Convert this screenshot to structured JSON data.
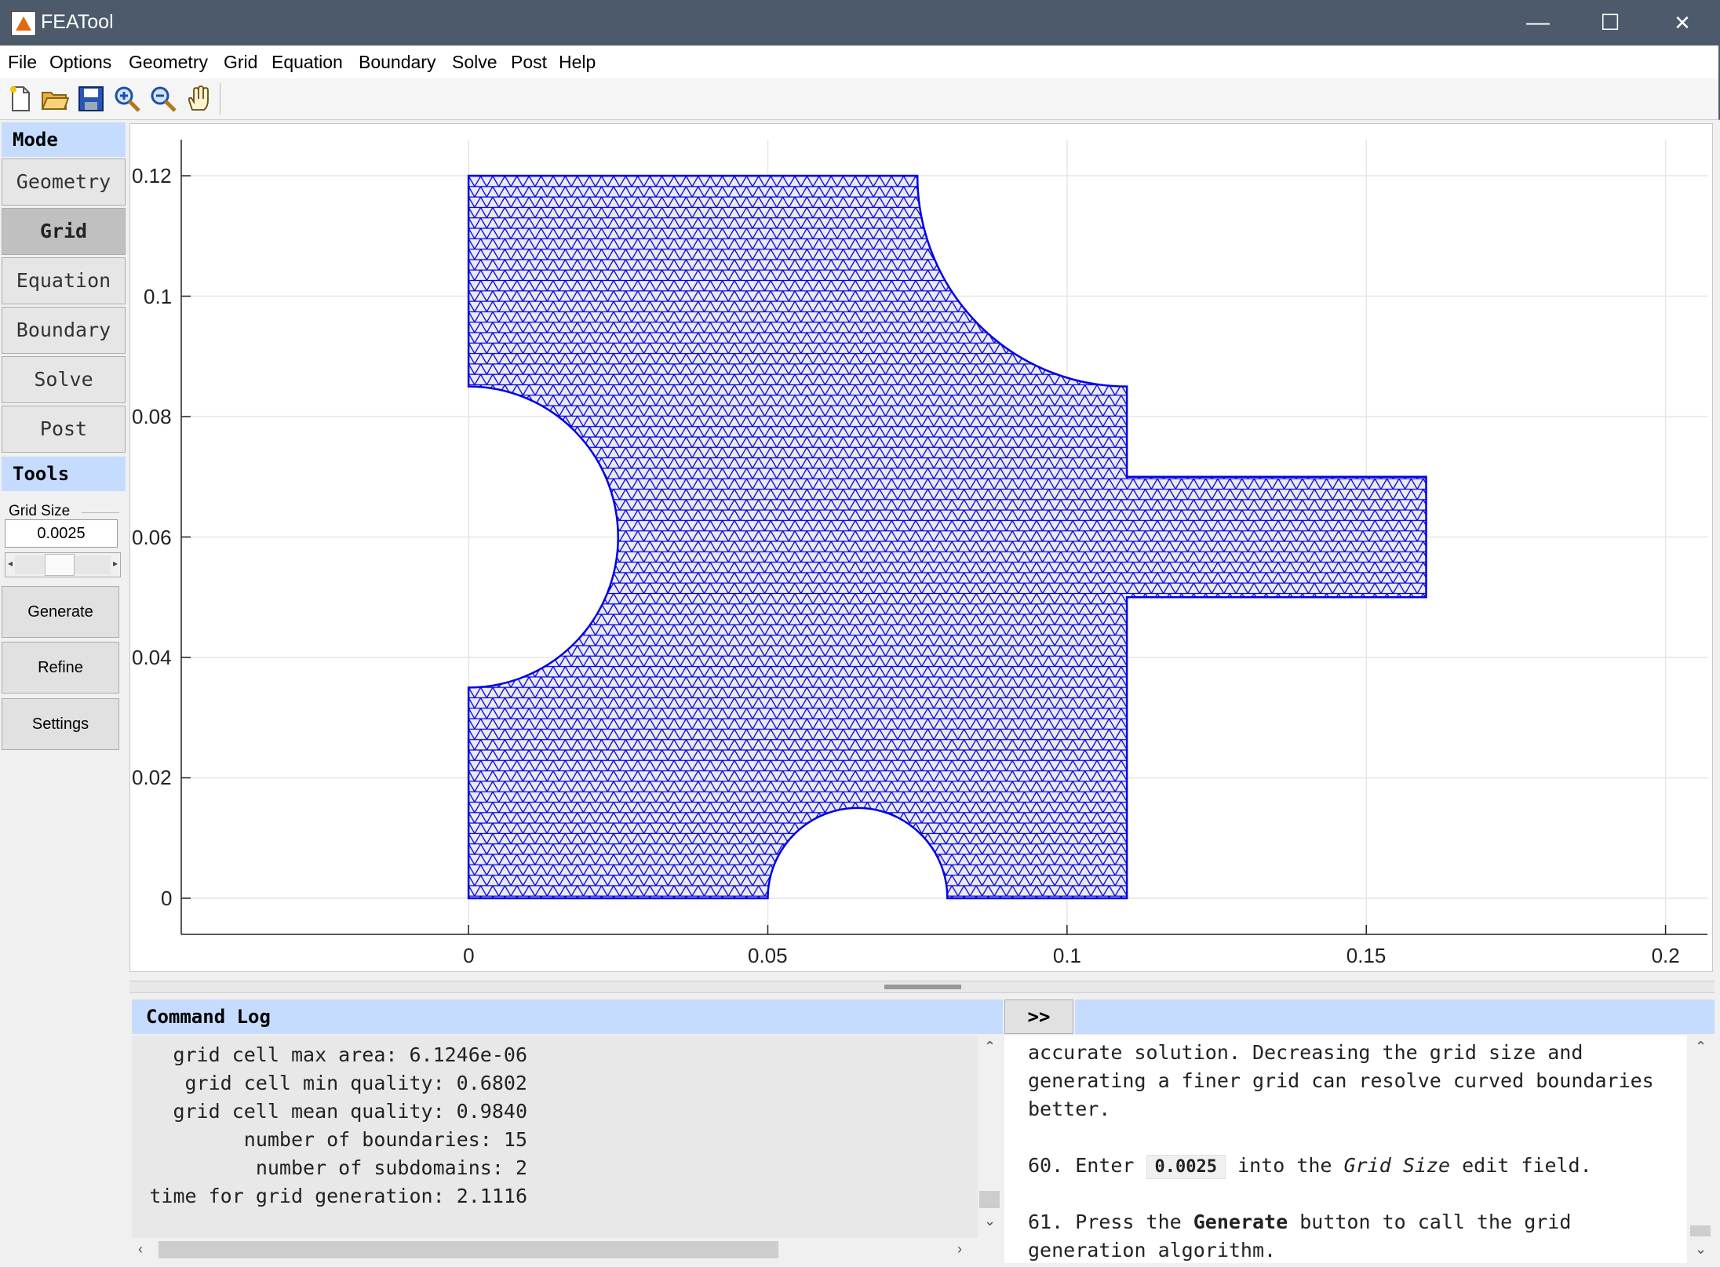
{
  "window": {
    "title": "FEATool",
    "minimize_glyph": "—",
    "maximize_glyph": "☐",
    "close_glyph": "✕"
  },
  "menu": [
    "File",
    "Options",
    "Geometry",
    "Grid",
    "Equation",
    "Boundary",
    "Solve",
    "Post",
    "Help"
  ],
  "toolbar": {
    "icons": [
      "new-file-icon",
      "open-folder-icon",
      "save-icon",
      "zoom-in-icon",
      "zoom-out-icon",
      "pan-hand-icon"
    ]
  },
  "sidebar": {
    "mode_header": "Mode",
    "modes": [
      "Geometry",
      "Grid",
      "Equation",
      "Boundary",
      "Solve",
      "Post"
    ],
    "active_mode": "Grid",
    "tools_header": "Tools",
    "grid_size_label": "Grid Size",
    "grid_size_value": "0.0025",
    "buttons": [
      "Generate",
      "Refine",
      "Settings"
    ]
  },
  "plot": {
    "xticks": [
      "0",
      "0.05",
      "0.1",
      "0.15",
      "0.2"
    ],
    "yticks": [
      "0",
      "0.02",
      "0.04",
      "0.06",
      "0.08",
      "0.1",
      "0.12"
    ],
    "xlim": [
      -0.048,
      0.207
    ],
    "ylim": [
      -0.006,
      0.126
    ],
    "mesh_color": "#0000e6",
    "grid": true
  },
  "command_log": {
    "header": "Command Log",
    "expand_label": ">>",
    "lines": [
      "grid cell max area: 6.1246e-06",
      "grid cell min quality: 0.6802",
      "grid cell mean quality: 0.9840",
      "number of boundaries: 15",
      "number of subdomains: 2",
      "time for grid generation: 2.1116"
    ]
  },
  "help": {
    "p1": "accurate solution. Decreasing the grid size and generating a finer grid can resolve curved boundaries better.",
    "p2_pre": "60. Enter",
    "p2_code": "0.0025",
    "p2_mid": "into the",
    "p2_em": "Grid Size",
    "p2_post": "edit field.",
    "p3_pre": "61. Press the",
    "p3_bold": "Generate",
    "p3_post": "button to call the grid generation algorithm."
  }
}
